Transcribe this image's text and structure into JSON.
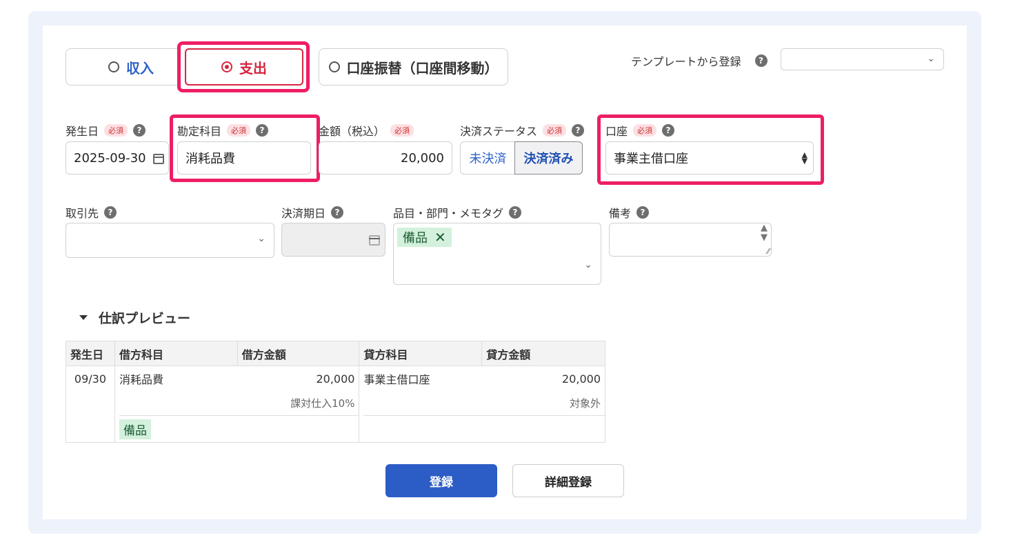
{
  "type_tabs": {
    "income": "収入",
    "expense": "支出",
    "transfer": "口座振替（口座間移動）"
  },
  "template": {
    "label": "テンプレートから登録",
    "value": ""
  },
  "required_badge": "必須",
  "help_glyph": "?",
  "fields": {
    "date": {
      "label": "発生日",
      "value": "2025-09-30"
    },
    "account_item": {
      "label": "勘定科目",
      "value": "消耗品費"
    },
    "amount": {
      "label": "金額（税込）",
      "value": "20,000"
    },
    "settlement_status": {
      "label": "決済ステータス",
      "options": [
        "未決済",
        "決済済み"
      ],
      "selected": "決済済み"
    },
    "bank_account": {
      "label": "口座",
      "value": "事業主借口座"
    },
    "partner": {
      "label": "取引先",
      "value": ""
    },
    "due_date": {
      "label": "決済期日",
      "value": ""
    },
    "items_tags": {
      "label": "品目・部門・メモタグ",
      "tags": [
        "備品"
      ]
    },
    "memo": {
      "label": "備考",
      "value": ""
    }
  },
  "preview": {
    "title": "仕訳プレビュー",
    "headers": [
      "発生日",
      "借方科目",
      "借方金額",
      "貸方科目",
      "貸方金額"
    ],
    "row": {
      "date": "09/30",
      "debit_account": "消耗品費",
      "debit_amount": "20,000",
      "debit_tax": "課対仕入10%",
      "debit_tag": "備品",
      "credit_account": "事業主借口座",
      "credit_amount": "20,000",
      "credit_tax": "対象外"
    }
  },
  "buttons": {
    "register": "登録",
    "detail_register": "詳細登録"
  },
  "colors": {
    "highlight": "#ee1e63",
    "expense_red": "#d6243f",
    "primary_blue": "#2c5cc5",
    "tag_green_bg": "#d3f1dc"
  }
}
